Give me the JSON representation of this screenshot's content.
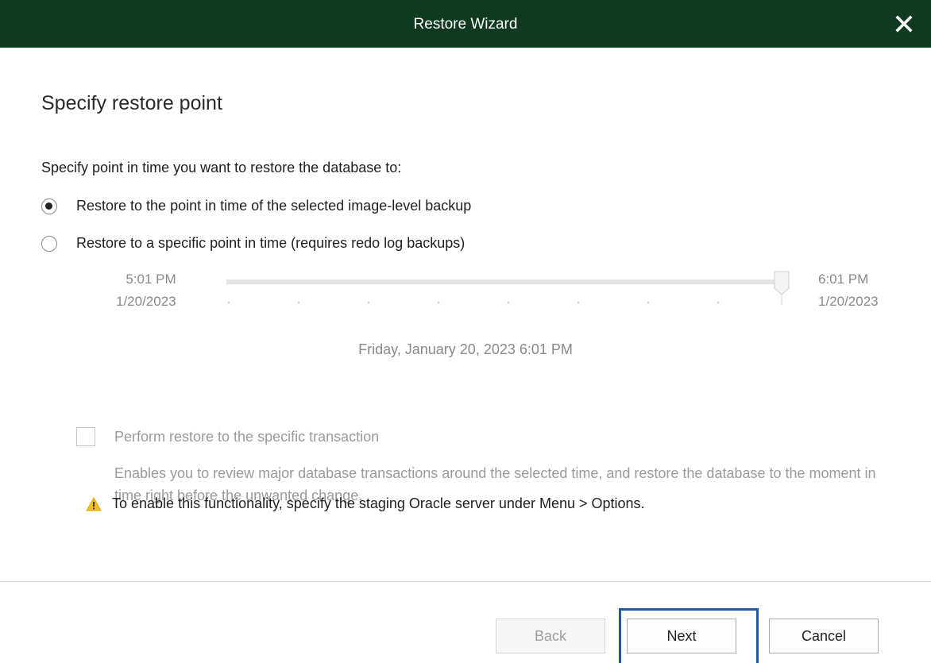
{
  "window": {
    "title": "Restore Wizard",
    "close_icon": "close-icon"
  },
  "page": {
    "heading": "Specify restore point",
    "prompt": "Specify point in time you want to restore the database to:"
  },
  "options": {
    "image_level": {
      "label": "Restore to the point in time of the selected image-level backup",
      "selected": true
    },
    "specific_point": {
      "label": "Restore to a specific point in time (requires redo log backups)",
      "selected": false
    }
  },
  "slider": {
    "start_time": "5:01 PM",
    "start_date": "1/20/2023",
    "end_time": "6:01 PM",
    "end_date": "1/20/2023",
    "position_fraction": 1.0,
    "selected_label": "Friday, January 20, 2023 6:01 PM"
  },
  "transaction": {
    "checkbox_label": "Perform restore to the specific transaction",
    "checked": false,
    "description": "Enables you to review major database transactions around the selected time, and restore the database to the moment in time right before the unwanted change.",
    "warning_icon": "warning-icon",
    "warning_text": "To enable this functionality, specify the staging Oracle server under Menu > Options."
  },
  "buttons": {
    "back": "Back",
    "next": "Next",
    "cancel": "Cancel"
  },
  "colors": {
    "titlebar": "#0f3a1f",
    "focus_highlight": "#1f56a8",
    "warning": "#f2c018"
  }
}
